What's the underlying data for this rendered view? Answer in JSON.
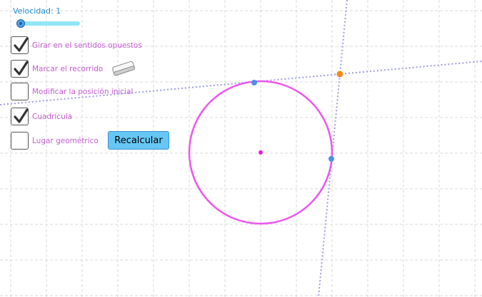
{
  "slider": {
    "label": "Velocidad: 1",
    "value": 1
  },
  "checkboxes": [
    {
      "label": "Girar en el sentidos opuestos",
      "checked": true
    },
    {
      "label": "Marcar el recorrido",
      "checked": true
    },
    {
      "label": "Modificar la posición inicial",
      "checked": false
    },
    {
      "label": "Cuadrícula",
      "checked": true
    },
    {
      "label": "Lugar geométrico",
      "checked": false
    }
  ],
  "buttons": {
    "recalcular": "Recalcular"
  },
  "icons": {
    "eraser": "eraser-icon"
  },
  "colors": {
    "circle": "#ee55ee",
    "lines": "#9b9be8",
    "point_blue": "#4b8ff0",
    "point_orange": "#ef8a1c",
    "center": "#e91ae0",
    "label_text": "#c45cd1",
    "grid": "#d8d8d8"
  }
}
